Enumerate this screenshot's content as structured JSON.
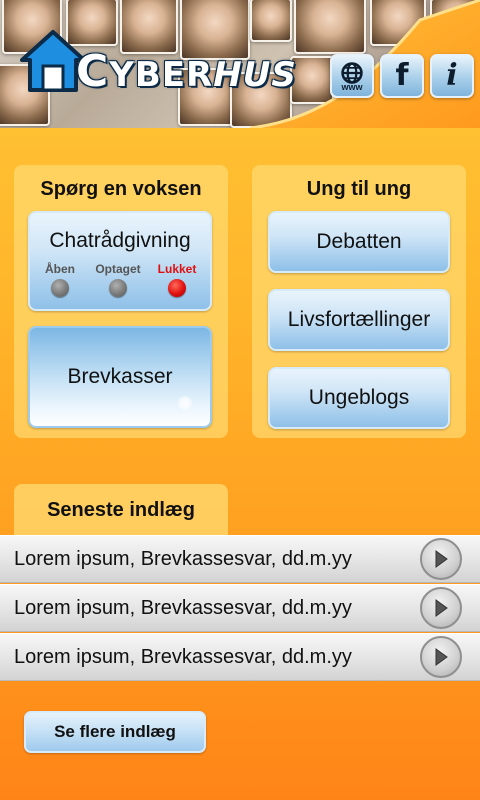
{
  "header": {
    "logo_prefix": "C",
    "logo_mid": "YBER",
    "logo_suffix": "HUS",
    "icons": [
      {
        "name": "globe-icon",
        "glyph": "🌐",
        "caption": "www"
      },
      {
        "name": "facebook-icon",
        "glyph": "f"
      },
      {
        "name": "info-icon",
        "glyph": "i"
      }
    ]
  },
  "ask_adult": {
    "title": "Spørg en voksen",
    "chat": {
      "label": "Chatrådgivning",
      "statuses": [
        {
          "label": "Åben",
          "color": "#7a7a7a"
        },
        {
          "label": "Optaget",
          "color": "#7a7a7a"
        },
        {
          "label": "Lukket",
          "color": "#e01010"
        }
      ]
    },
    "mailbox_label": "Brevkasser"
  },
  "youth": {
    "title": "Ung til ung",
    "buttons": [
      "Debatten",
      "Livsfortællinger",
      "Ungeblogs"
    ]
  },
  "latest": {
    "title": "Seneste indlæg",
    "posts": [
      "Lorem ipsum, Brevkassesvar, dd.m.yy",
      "Lorem ipsum, Brevkassesvar, dd.m.yy",
      "Lorem ipsum, Brevkassesvar, dd.m.yy"
    ],
    "more_label": "Se flere indlæg"
  },
  "colors": {
    "accent": "#ff9a1e",
    "panel": "#ffd86e",
    "button": "#a8cfee",
    "status_closed": "#e01010"
  }
}
